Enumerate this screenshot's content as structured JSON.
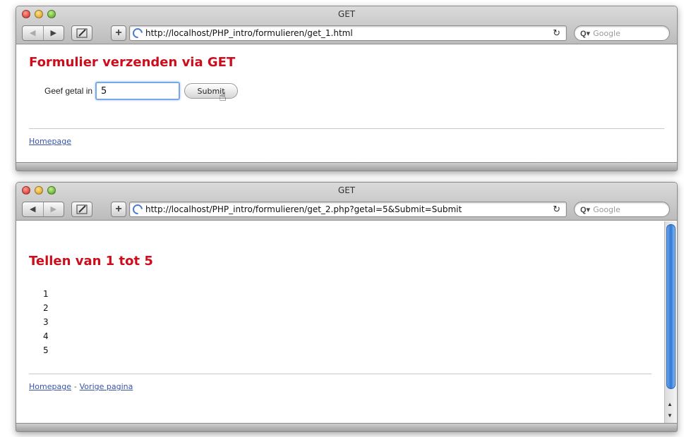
{
  "window1": {
    "title": "GET",
    "url": "http://localhost/PHP_intro/formulieren/get_1.html",
    "search_placeholder": "Google",
    "heading": "Formulier verzenden via GET",
    "form": {
      "label": "Geef getal in",
      "value": "5",
      "submit_label": "Submit"
    },
    "footer": {
      "home_link": "Homepage"
    }
  },
  "window2": {
    "title": "GET",
    "url": "http://localhost/PHP_intro/formulieren/get_2.php?getal=5&Submit=Submit",
    "search_placeholder": "Google",
    "heading": "Tellen van 1 tot 5",
    "numbers": [
      "1",
      "2",
      "3",
      "4",
      "5"
    ],
    "footer": {
      "home_link": "Homepage",
      "separator": "-",
      "prev_link": "Vorige pagina"
    }
  },
  "toolbar": {
    "back_glyph": "◀",
    "forward_glyph": "▶",
    "add_glyph": "+",
    "reload_glyph": "↻",
    "search_glyph": "Q▾"
  },
  "colors": {
    "heading": "#cc0d1c",
    "link": "#3a54a8",
    "focus": "#7aa7e8"
  }
}
